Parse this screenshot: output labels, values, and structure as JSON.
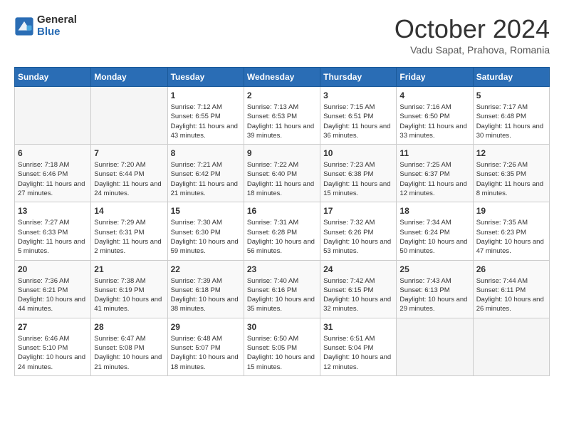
{
  "logo": {
    "general": "General",
    "blue": "Blue"
  },
  "title": "October 2024",
  "subtitle": "Vadu Sapat, Prahova, Romania",
  "headers": [
    "Sunday",
    "Monday",
    "Tuesday",
    "Wednesday",
    "Thursday",
    "Friday",
    "Saturday"
  ],
  "weeks": [
    [
      {
        "day": "",
        "info": ""
      },
      {
        "day": "",
        "info": ""
      },
      {
        "day": "1",
        "info": "Sunrise: 7:12 AM\nSunset: 6:55 PM\nDaylight: 11 hours and 43 minutes."
      },
      {
        "day": "2",
        "info": "Sunrise: 7:13 AM\nSunset: 6:53 PM\nDaylight: 11 hours and 39 minutes."
      },
      {
        "day": "3",
        "info": "Sunrise: 7:15 AM\nSunset: 6:51 PM\nDaylight: 11 hours and 36 minutes."
      },
      {
        "day": "4",
        "info": "Sunrise: 7:16 AM\nSunset: 6:50 PM\nDaylight: 11 hours and 33 minutes."
      },
      {
        "day": "5",
        "info": "Sunrise: 7:17 AM\nSunset: 6:48 PM\nDaylight: 11 hours and 30 minutes."
      }
    ],
    [
      {
        "day": "6",
        "info": "Sunrise: 7:18 AM\nSunset: 6:46 PM\nDaylight: 11 hours and 27 minutes."
      },
      {
        "day": "7",
        "info": "Sunrise: 7:20 AM\nSunset: 6:44 PM\nDaylight: 11 hours and 24 minutes."
      },
      {
        "day": "8",
        "info": "Sunrise: 7:21 AM\nSunset: 6:42 PM\nDaylight: 11 hours and 21 minutes."
      },
      {
        "day": "9",
        "info": "Sunrise: 7:22 AM\nSunset: 6:40 PM\nDaylight: 11 hours and 18 minutes."
      },
      {
        "day": "10",
        "info": "Sunrise: 7:23 AM\nSunset: 6:38 PM\nDaylight: 11 hours and 15 minutes."
      },
      {
        "day": "11",
        "info": "Sunrise: 7:25 AM\nSunset: 6:37 PM\nDaylight: 11 hours and 12 minutes."
      },
      {
        "day": "12",
        "info": "Sunrise: 7:26 AM\nSunset: 6:35 PM\nDaylight: 11 hours and 8 minutes."
      }
    ],
    [
      {
        "day": "13",
        "info": "Sunrise: 7:27 AM\nSunset: 6:33 PM\nDaylight: 11 hours and 5 minutes."
      },
      {
        "day": "14",
        "info": "Sunrise: 7:29 AM\nSunset: 6:31 PM\nDaylight: 11 hours and 2 minutes."
      },
      {
        "day": "15",
        "info": "Sunrise: 7:30 AM\nSunset: 6:30 PM\nDaylight: 10 hours and 59 minutes."
      },
      {
        "day": "16",
        "info": "Sunrise: 7:31 AM\nSunset: 6:28 PM\nDaylight: 10 hours and 56 minutes."
      },
      {
        "day": "17",
        "info": "Sunrise: 7:32 AM\nSunset: 6:26 PM\nDaylight: 10 hours and 53 minutes."
      },
      {
        "day": "18",
        "info": "Sunrise: 7:34 AM\nSunset: 6:24 PM\nDaylight: 10 hours and 50 minutes."
      },
      {
        "day": "19",
        "info": "Sunrise: 7:35 AM\nSunset: 6:23 PM\nDaylight: 10 hours and 47 minutes."
      }
    ],
    [
      {
        "day": "20",
        "info": "Sunrise: 7:36 AM\nSunset: 6:21 PM\nDaylight: 10 hours and 44 minutes."
      },
      {
        "day": "21",
        "info": "Sunrise: 7:38 AM\nSunset: 6:19 PM\nDaylight: 10 hours and 41 minutes."
      },
      {
        "day": "22",
        "info": "Sunrise: 7:39 AM\nSunset: 6:18 PM\nDaylight: 10 hours and 38 minutes."
      },
      {
        "day": "23",
        "info": "Sunrise: 7:40 AM\nSunset: 6:16 PM\nDaylight: 10 hours and 35 minutes."
      },
      {
        "day": "24",
        "info": "Sunrise: 7:42 AM\nSunset: 6:15 PM\nDaylight: 10 hours and 32 minutes."
      },
      {
        "day": "25",
        "info": "Sunrise: 7:43 AM\nSunset: 6:13 PM\nDaylight: 10 hours and 29 minutes."
      },
      {
        "day": "26",
        "info": "Sunrise: 7:44 AM\nSunset: 6:11 PM\nDaylight: 10 hours and 26 minutes."
      }
    ],
    [
      {
        "day": "27",
        "info": "Sunrise: 6:46 AM\nSunset: 5:10 PM\nDaylight: 10 hours and 24 minutes."
      },
      {
        "day": "28",
        "info": "Sunrise: 6:47 AM\nSunset: 5:08 PM\nDaylight: 10 hours and 21 minutes."
      },
      {
        "day": "29",
        "info": "Sunrise: 6:48 AM\nSunset: 5:07 PM\nDaylight: 10 hours and 18 minutes."
      },
      {
        "day": "30",
        "info": "Sunrise: 6:50 AM\nSunset: 5:05 PM\nDaylight: 10 hours and 15 minutes."
      },
      {
        "day": "31",
        "info": "Sunrise: 6:51 AM\nSunset: 5:04 PM\nDaylight: 10 hours and 12 minutes."
      },
      {
        "day": "",
        "info": ""
      },
      {
        "day": "",
        "info": ""
      }
    ]
  ]
}
